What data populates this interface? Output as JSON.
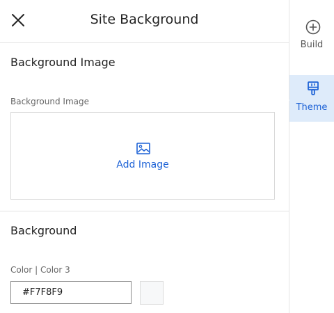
{
  "panel": {
    "title": "Site Background",
    "background_image": {
      "section_title": "Background Image",
      "field_label": "Background Image",
      "add_label": "Add Image",
      "icon": "image-icon"
    },
    "background": {
      "section_title": "Background",
      "color_label": "Color | Color 3",
      "color_value": "#F7F8F9",
      "swatch_color": "#F7F8F9"
    }
  },
  "side_nav": {
    "items": [
      {
        "label": "Build",
        "icon": "plus-circle-icon",
        "active": false
      },
      {
        "label": "Theme",
        "icon": "paintbrush-icon",
        "active": true
      }
    ]
  },
  "colors": {
    "accent": "#1D62D6",
    "active_nav_bg": "#DEEBFA"
  }
}
